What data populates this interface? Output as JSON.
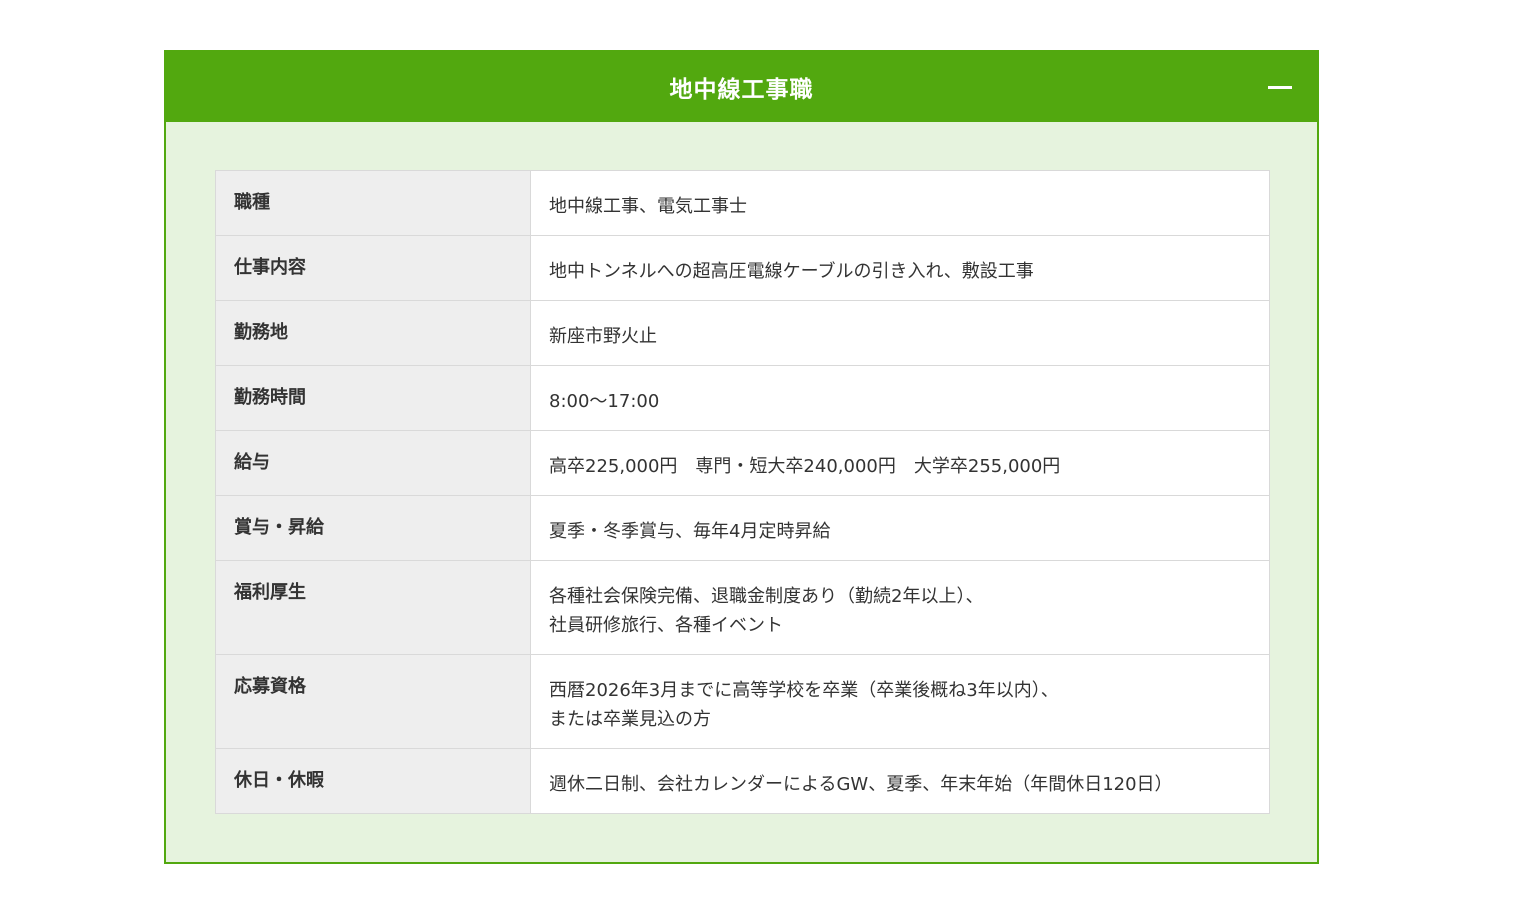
{
  "section": {
    "title": "地中線工事職",
    "toggle_icon": "minus-icon"
  },
  "colors": {
    "header": "#52a80f",
    "body_bg": "#e6f3de",
    "label_bg": "#eeeeee"
  },
  "rows": [
    {
      "label": "職種",
      "lines": [
        "地中線工事、電気工事士"
      ]
    },
    {
      "label": "仕事内容",
      "lines": [
        "地中トンネルへの超高圧電線ケーブルの引き入れ、敷設工事"
      ]
    },
    {
      "label": "勤務地",
      "lines": [
        "新座市野火止"
      ]
    },
    {
      "label": "勤務時間",
      "lines": [
        "8:00〜17:00"
      ]
    },
    {
      "label": "給与",
      "lines": [
        "高卒225,000円　専門・短大卒240,000円　大学卒255,000円"
      ]
    },
    {
      "label": "賞与・昇給",
      "lines": [
        "夏季・冬季賞与、毎年4月定時昇給"
      ]
    },
    {
      "label": "福利厚生",
      "lines": [
        "各種社会保険完備、退職金制度あり（勤続2年以上）、",
        "社員研修旅行、各種イベント"
      ]
    },
    {
      "label": "応募資格",
      "lines": [
        "西暦2026年3月までに高等学校を卒業（卒業後概ね3年以内）、",
        "または卒業見込の方"
      ]
    },
    {
      "label": "休日・休暇",
      "lines": [
        "週休二日制、会社カレンダーによるGW、夏季、年末年始（年間休日120日）"
      ]
    }
  ]
}
